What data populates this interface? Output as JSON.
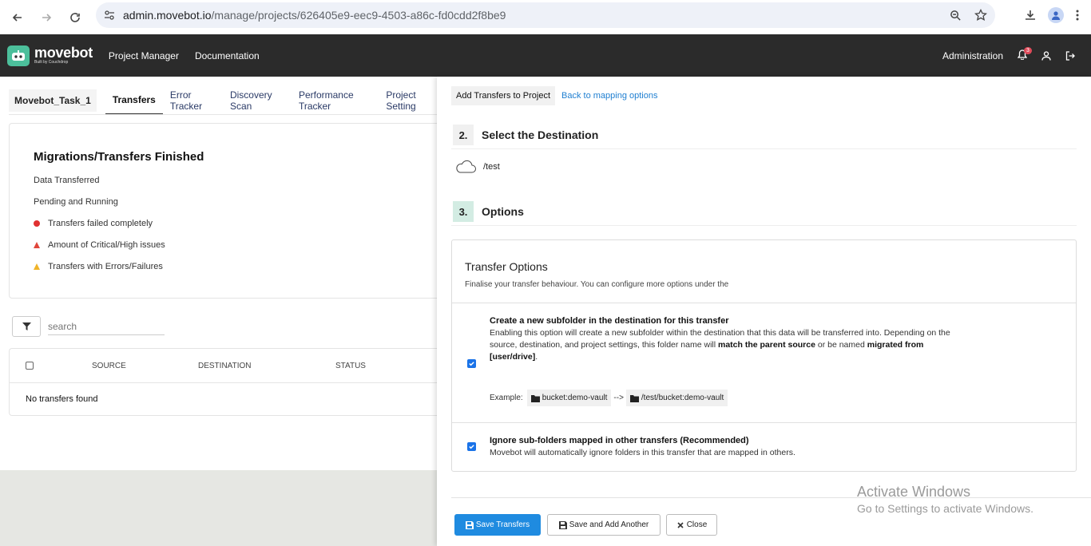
{
  "browser": {
    "url_host": "admin.movebot.io",
    "url_path": "/manage/projects/626405e9-eec9-4503-a86c-fd0cdd2f8be9"
  },
  "header": {
    "logo_name": "movebot",
    "logo_sub": "Built by Couchdrop",
    "nav": [
      "Project Manager",
      "Documentation"
    ],
    "admin": "Administration",
    "notif_count": "3"
  },
  "tabs": {
    "task": "Movebot_Task_1",
    "items": [
      "Transfers",
      "Error Tracker",
      "Discovery Scan",
      "Performance Tracker",
      "Project Setting"
    ]
  },
  "summary": {
    "title": "Migrations/Transfers Finished",
    "items": [
      "Data Transferred",
      "Pending and Running",
      "Transfers failed completely",
      "Amount of Critical/High issues",
      "Transfers with Errors/Failures"
    ]
  },
  "search": {
    "placeholder": "search"
  },
  "table": {
    "columns": [
      "SOURCE",
      "DESTINATION",
      "STATUS"
    ],
    "empty": "No transfers found"
  },
  "panel": {
    "tab_active": "Add Transfers to Project",
    "tab_link": "Back to mapping options",
    "step2_num": "2.",
    "step2_title": "Select the Destination",
    "destination_path": "/test",
    "step3_num": "3.",
    "step3_title": "Options",
    "options_title": "Transfer Options",
    "options_sub": "Finalise your transfer behaviour. You can configure more options under the",
    "opt1_title": "Create a new subfolder in the destination for this transfer",
    "opt1_desc_a": "Enabling this option will create a new subfolder within the destination that this data will be transferred into. Depending on the source, destination, and project settings, this folder name will ",
    "opt1_desc_b1": "match the parent source",
    "opt1_desc_c": " or be named ",
    "opt1_desc_b2": "migrated from [user/drive]",
    "opt1_desc_d": ".",
    "example_label": "Example:",
    "example_src": "bucket:demo-vault",
    "example_arrow": "-->",
    "example_dst": "/test/bucket:demo-vault",
    "opt2_title": "Ignore sub-folders mapped in other transfers (Recommended)",
    "opt2_desc": "Movebot will automatically ignore folders in this transfer that are mapped in others.",
    "btn_save": "Save Transfers",
    "btn_save_add": "Save and Add Another",
    "btn_close": "Close"
  },
  "watermark": {
    "line1": "Activate Windows",
    "line2": "Go to Settings to activate Windows."
  }
}
